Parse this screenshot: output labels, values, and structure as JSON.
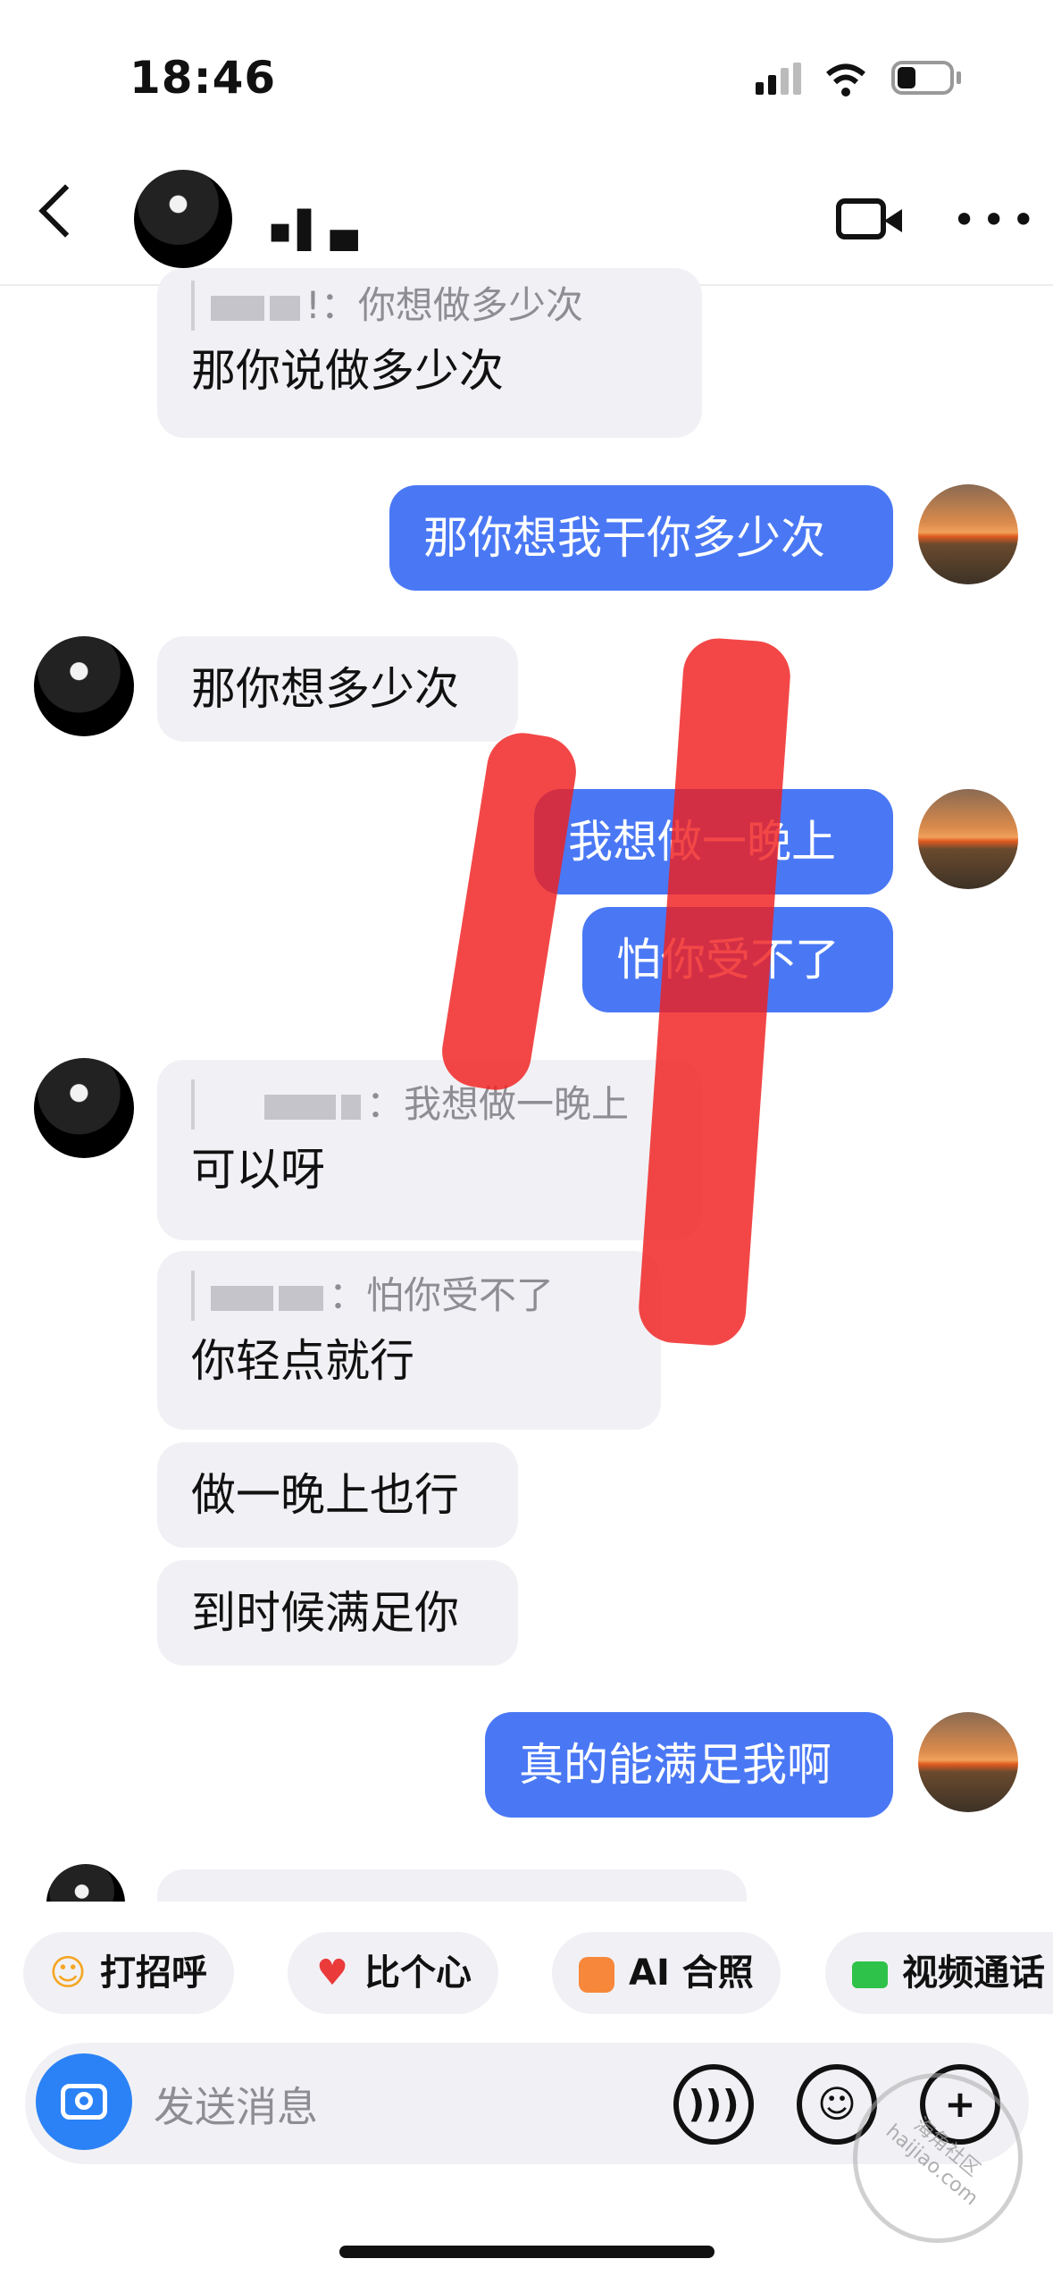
{
  "status_bar": {
    "time": "18:46"
  },
  "header": {
    "contact_name": "▪▌▄"
  },
  "messages": [
    {
      "side": "in",
      "quote_text": "你想做多少次",
      "text": "那你说做多少次"
    },
    {
      "side": "out",
      "text": "那你想我干你多少次"
    },
    {
      "side": "in",
      "text": "那你想多少次"
    },
    {
      "side": "out",
      "text": "我想做一晚上"
    },
    {
      "side": "out",
      "text": "怕你受不了"
    },
    {
      "side": "in",
      "quote_text": "我想做一晚上",
      "text": "可以呀"
    },
    {
      "side": "in",
      "quote_text": "怕你受不了",
      "text": "你轻点就行"
    },
    {
      "side": "in",
      "text": "做一晚上也行"
    },
    {
      "side": "in",
      "text": "到时候满足你"
    },
    {
      "side": "out",
      "text": "真的能满足我啊"
    }
  ],
  "quick_actions": [
    {
      "label": "打招呼",
      "icon": "wave-emoji-icon"
    },
    {
      "label": "比个心",
      "icon": "heart-icon"
    },
    {
      "label": "AI 合照",
      "icon": "ai-photo-icon"
    },
    {
      "label": "视频通话",
      "icon": "video-call-icon"
    }
  ],
  "input": {
    "placeholder": "发送消息"
  },
  "watermark": {
    "text": "海角社区",
    "url": "haijiao.com"
  },
  "colors": {
    "outgoing_bubble": "#4a78f5",
    "incoming_bubble": "#f1f1f5",
    "camera_button": "#2b82f6",
    "red_annotation": "#f01e1e"
  }
}
